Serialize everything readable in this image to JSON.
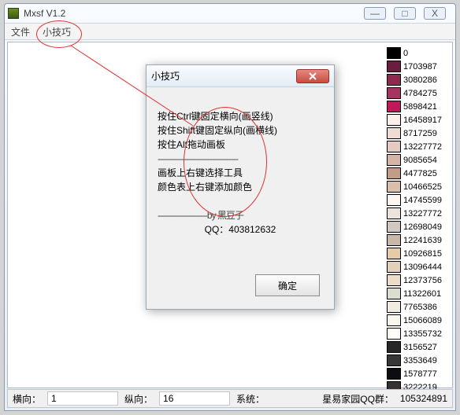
{
  "window": {
    "title": "Mxsf V1.2",
    "minimize": "—",
    "maximize": "□",
    "close": "X"
  },
  "menu": {
    "file": "文件",
    "tips": "小技巧"
  },
  "dialog": {
    "title": "小技巧",
    "line1": "按住Ctrl键固定横向(画竖线)",
    "line2": "按住Shift键固定纵向(画横线)",
    "line3": "按住Alt拖动画板",
    "dash1": "----------------------------------",
    "line4": "画板上右键选择工具",
    "line5": "颜色表上右键添加颜色",
    "dash2": "---------------------by 黑豆子",
    "line6": "QQ：403812632",
    "ok": "确定"
  },
  "status": {
    "x_label": "横向：",
    "x_value": "1",
    "y_label": "纵向：",
    "y_value": "16",
    "sys_label": "系统：",
    "group_label": "星易家园QQ群：",
    "group_value": "105324891"
  },
  "colors": [
    {
      "hex": "#000000",
      "label": "0"
    },
    {
      "hex": "#6a1d3e",
      "label": "1703987"
    },
    {
      "hex": "#8e2a50",
      "label": "3080286"
    },
    {
      "hex": "#a33560",
      "label": "4784275"
    },
    {
      "hex": "#c1185a",
      "label": "5898421"
    },
    {
      "hex": "#fbefeb",
      "label": "16458917"
    },
    {
      "hex": "#efdcd5",
      "label": "8717259"
    },
    {
      "hex": "#e4cac1",
      "label": "13227772"
    },
    {
      "hex": "#d6b4a6",
      "label": "9085654"
    },
    {
      "hex": "#c19c88",
      "label": "4477825"
    },
    {
      "hex": "#d9bfa9",
      "label": "10466525"
    },
    {
      "hex": "#fbf7f0",
      "label": "14745599"
    },
    {
      "hex": "#ece3dc",
      "label": "13227772"
    },
    {
      "hex": "#d0c9c2",
      "label": "12698049"
    },
    {
      "hex": "#c8b9a7",
      "label": "12241639"
    },
    {
      "hex": "#e3cca6",
      "label": "10926815"
    },
    {
      "hex": "#e4cfba",
      "label": "13096444"
    },
    {
      "hex": "#ecdcca",
      "label": "12373756"
    },
    {
      "hex": "#dddcd1",
      "label": "11322601"
    },
    {
      "hex": "#f0ece2",
      "label": "7765386"
    },
    {
      "hex": "#f9f6ef",
      "label": "15066089"
    },
    {
      "hex": "#fdfcf6",
      "label": "13355732"
    },
    {
      "hex": "#272727",
      "label": "3156527"
    },
    {
      "hex": "#393636",
      "label": "3353649"
    },
    {
      "hex": "#0d0d11",
      "label": "1578777"
    },
    {
      "hex": "#373030",
      "label": "3222219"
    }
  ]
}
